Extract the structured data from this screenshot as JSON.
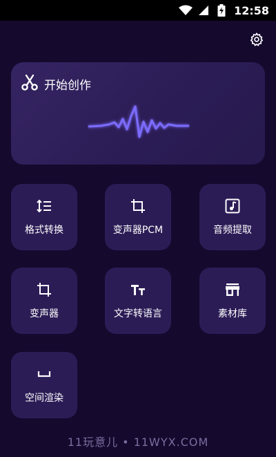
{
  "status": {
    "time": "12:58"
  },
  "hero": {
    "title": "开始创作"
  },
  "tiles": [
    {
      "label": "格式转换"
    },
    {
      "label": "变声器PCM"
    },
    {
      "label": "音频提取"
    },
    {
      "label": "变声器"
    },
    {
      "label": "文字转语言"
    },
    {
      "label": "素材库"
    },
    {
      "label": "空间渲染"
    }
  ],
  "watermark": "11玩意儿 • 11WYX.COM",
  "colors": {
    "background": "#16092e",
    "card": "#2c1c56",
    "hero_card": "#352462",
    "wave": "#7c6cff"
  }
}
